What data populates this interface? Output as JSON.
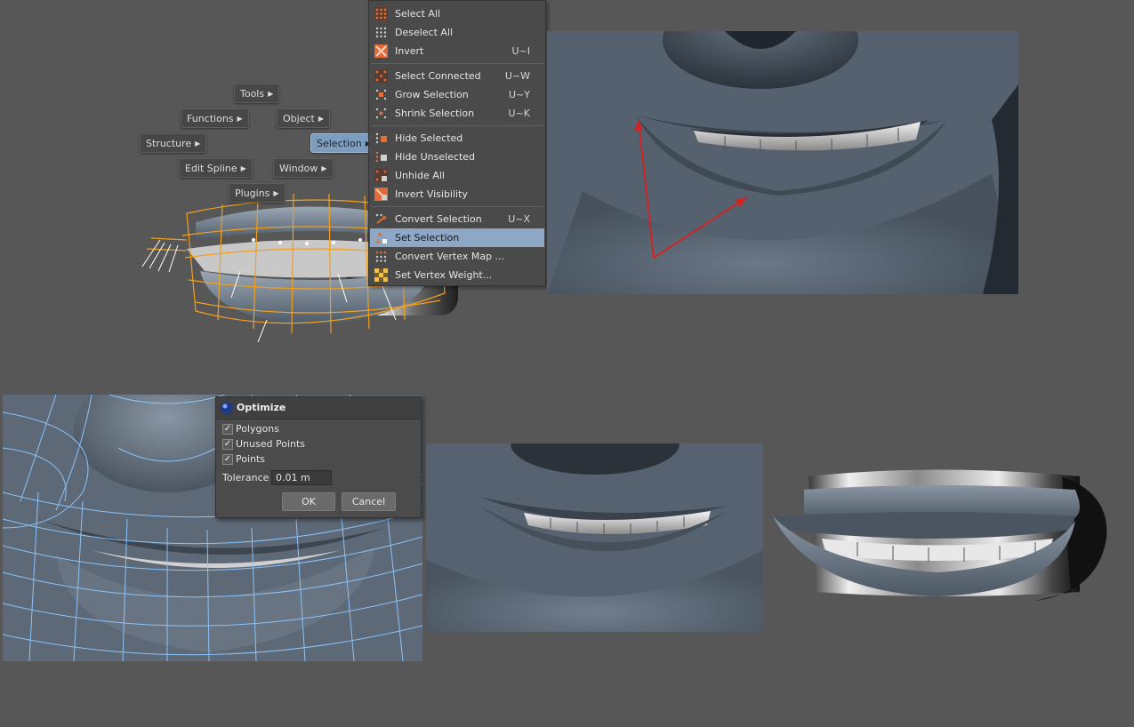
{
  "hud_buttons": {
    "tools": "Tools",
    "functions": "Functions",
    "object": "Object",
    "structure": "Structure",
    "selection": "Selection",
    "edit_spline": "Edit Spline",
    "window": "Window",
    "plugins": "Plugins"
  },
  "selection_menu": {
    "items": [
      {
        "label": "Select All",
        "shortcut": "",
        "icon": "select-all-icon"
      },
      {
        "label": "Deselect All",
        "shortcut": "",
        "icon": "deselect-all-icon"
      },
      {
        "label": "Invert",
        "shortcut": "U~I",
        "icon": "invert-icon"
      },
      {
        "label": "Select Connected",
        "shortcut": "U~W",
        "icon": "select-connected-icon"
      },
      {
        "label": "Grow Selection",
        "shortcut": "U~Y",
        "icon": "grow-selection-icon"
      },
      {
        "label": "Shrink Selection",
        "shortcut": "U~K",
        "icon": "shrink-selection-icon"
      },
      {
        "label": "Hide Selected",
        "shortcut": "",
        "icon": "hide-selected-icon"
      },
      {
        "label": "Hide Unselected",
        "shortcut": "",
        "icon": "hide-unselected-icon"
      },
      {
        "label": "Unhide All",
        "shortcut": "",
        "icon": "unhide-all-icon"
      },
      {
        "label": "Invert Visibility",
        "shortcut": "",
        "icon": "invert-visibility-icon"
      },
      {
        "label": "Convert Selection",
        "shortcut": "U~X",
        "icon": "convert-selection-icon"
      },
      {
        "label": "Set Selection",
        "shortcut": "",
        "icon": "set-selection-icon"
      },
      {
        "label": "Convert Vertex Map ...",
        "shortcut": "",
        "icon": "convert-vertex-map-icon"
      },
      {
        "label": "Set Vertex Weight...",
        "shortcut": "",
        "icon": "set-vertex-weight-icon"
      }
    ],
    "highlighted": "Set Selection"
  },
  "optimize_dialog": {
    "title": "Optimize",
    "polygons_label": "Polygons",
    "polygons_checked": true,
    "unused_points_label": "Unused Points",
    "unused_points_checked": true,
    "points_label": "Points",
    "points_checked": true,
    "tolerance_label": "Tolerance",
    "tolerance_value": "0.01 m",
    "ok_label": "OK",
    "cancel_label": "Cancel"
  },
  "colors": {
    "background": "#575757",
    "menu_highlight": "#8ea7c4",
    "selection_wire": "#f0a020",
    "mesh_wire": "#8ec8ff",
    "annotation_arrow": "#d82020",
    "skin": "#6b7886"
  }
}
